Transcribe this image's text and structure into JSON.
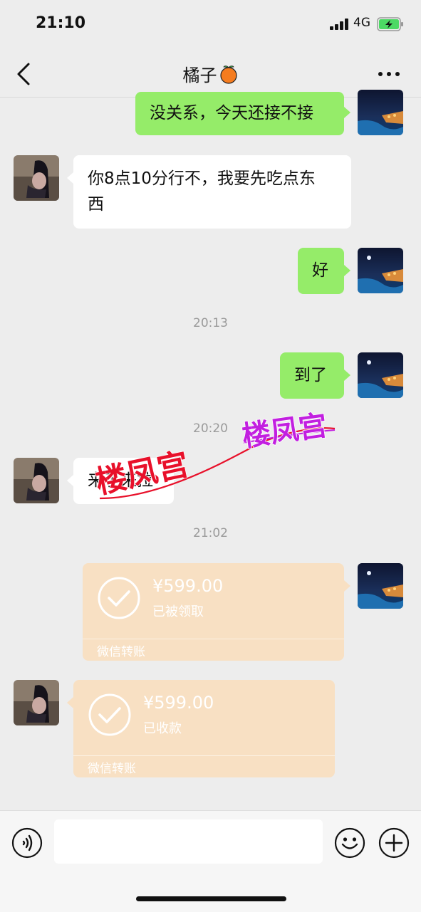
{
  "status_bar": {
    "time": "21:10",
    "network": "4G"
  },
  "nav": {
    "title": "橘子",
    "title_emoji": "orange-emoji"
  },
  "messages": [
    {
      "side": "right",
      "type": "text",
      "text": "没关系，今天还接不接"
    },
    {
      "side": "left",
      "type": "text",
      "line1": "你8点10分行不，我要先吃点东",
      "line2": "西"
    },
    {
      "side": "right",
      "type": "text",
      "text": "好"
    },
    {
      "type": "time",
      "text": "20:13"
    },
    {
      "side": "right",
      "type": "text",
      "text": "到了"
    },
    {
      "type": "time",
      "text": "20:20"
    },
    {
      "side": "left",
      "type": "text",
      "text": "来了来拉"
    },
    {
      "type": "time",
      "text": "21:02"
    },
    {
      "side": "right",
      "type": "transfer",
      "amount": "¥599.00",
      "status": "已被领取",
      "label": "微信转账"
    },
    {
      "side": "left",
      "type": "transfer",
      "amount": "¥599.00",
      "status": "已收款",
      "label": "微信转账"
    }
  ],
  "watermark": {
    "text": "楼凤宫"
  },
  "input_bar": {
    "placeholder": ""
  },
  "colors": {
    "sent_bubble": "#95ec69",
    "received_bubble": "#ffffff",
    "transfer_card": "#f8e0c3",
    "background": "#ededed",
    "watermark_red": "#e8102a",
    "watermark_purple": "#c21fe0"
  }
}
